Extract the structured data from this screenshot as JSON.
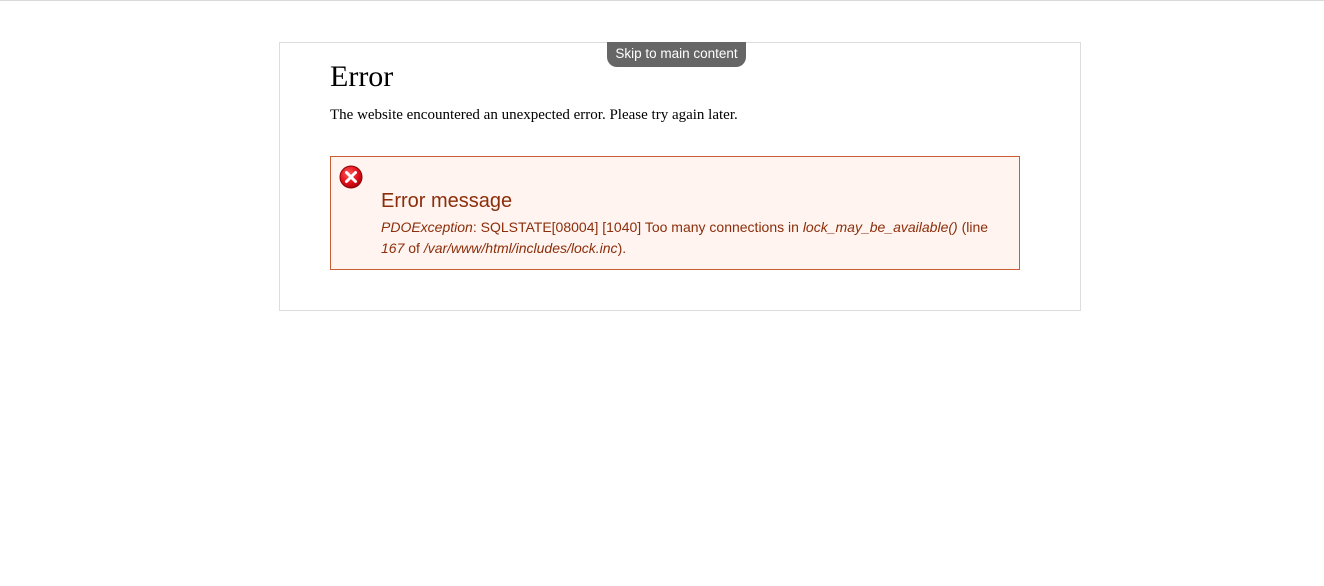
{
  "skip_link": {
    "label": "Skip to main content"
  },
  "page": {
    "title": "Error",
    "intro": "The website encountered an unexpected error. Please try again later."
  },
  "error_message": {
    "icon": "error-x-icon",
    "heading": "Error message",
    "exception": "PDOException",
    "details": ": SQLSTATE[08004] [1040] Too many connections in ",
    "function": "lock_may_be_available()",
    "line_prefix": " (line ",
    "line_number": "167",
    "of_text": " of ",
    "file_path": "/var/www/html/includes/lock.inc",
    "suffix": ")."
  },
  "colors": {
    "skip_link_bg": "#666666",
    "error_border": "#c85c35",
    "error_background": "#fff4ef",
    "error_text": "#8c2e0b",
    "icon_red": "#e2111b"
  }
}
